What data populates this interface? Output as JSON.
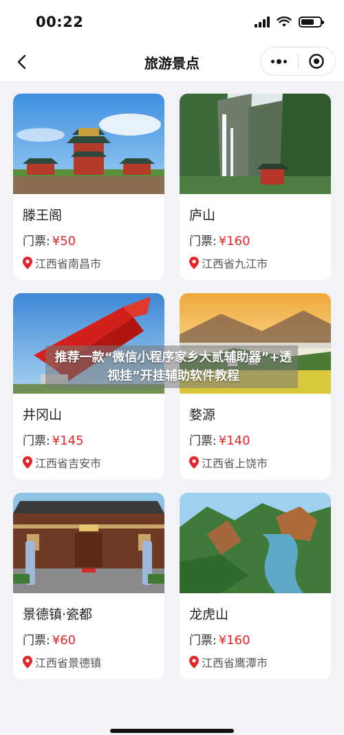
{
  "status_bar": {
    "time": "00:22",
    "battery_level": 0.7
  },
  "nav": {
    "title": "旅游景点",
    "back_icon": "chevron-left-icon",
    "more_icon": "more-dots-icon",
    "close_icon": "target-circle-icon"
  },
  "price_label": "门票:",
  "currency": "¥",
  "accent_color": "#e4262a",
  "attractions": [
    {
      "name": "滕王阁",
      "price": "50",
      "location": "江西省南昌市"
    },
    {
      "name": "庐山",
      "price": "160",
      "location": "江西省九江市"
    },
    {
      "name": "井冈山",
      "price": "145",
      "location": "江西省吉安市"
    },
    {
      "name": "婺源",
      "price": "140",
      "location": "江西省上饶市"
    },
    {
      "name": "景德镇·瓷都",
      "price": "60",
      "location": "江西省景德镇"
    },
    {
      "name": "龙虎山",
      "price": "160",
      "location": "江西省鹰潭市"
    }
  ],
  "overlay": {
    "text": "推荐一款“微信小程序家乡大贰辅助器”+透视挂”开挂辅助软件教程"
  }
}
